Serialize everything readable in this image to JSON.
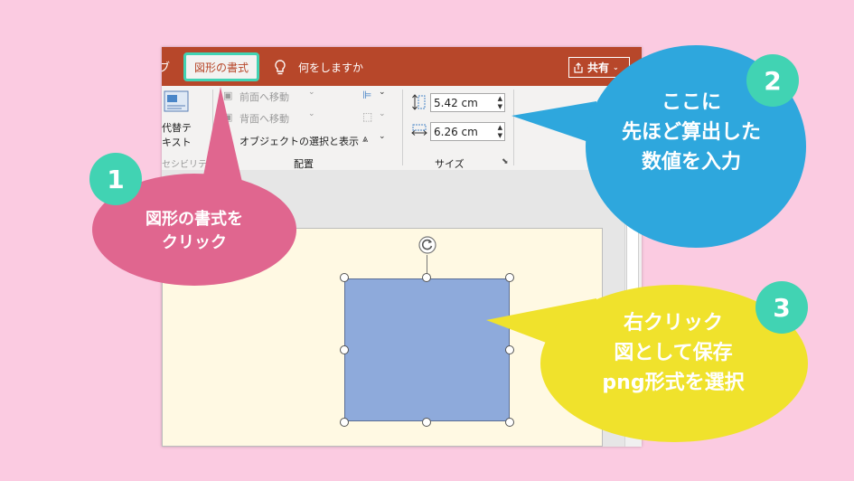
{
  "window": {
    "tab_prev": "ブ",
    "tab_active": "図形の書式",
    "tellme": "何をしますか",
    "share": "共有"
  },
  "ribbon": {
    "alt_text_line1": "代替テ",
    "alt_text_line2": "キスト",
    "accessibility_label": "セシビリティ",
    "bring_forward": "前面へ移動",
    "send_backward": "背面へ移動",
    "selection_pane": "オブジェクトの選択と表示",
    "arrange_label": "配置",
    "height_value": "5.42 cm",
    "width_value": "6.26 cm",
    "size_label": "サイズ"
  },
  "callouts": {
    "c1": {
      "number": "1",
      "line1": "図形の書式を",
      "line2": "クリック",
      "color": "#e0668f"
    },
    "c2": {
      "number": "2",
      "line1": "ここに",
      "line2": "先ほど算出した",
      "line3": "数値を入力",
      "color": "#2ea7dd"
    },
    "c3": {
      "number": "3",
      "line1": "右クリック",
      "line2": "図として保存",
      "line3": "png形式を選択",
      "color": "#f0e22c"
    }
  },
  "colors": {
    "background": "#fbcbe1",
    "titlebar": "#b7472a",
    "badge": "#41d3b3",
    "shape": "#8eaadb"
  }
}
